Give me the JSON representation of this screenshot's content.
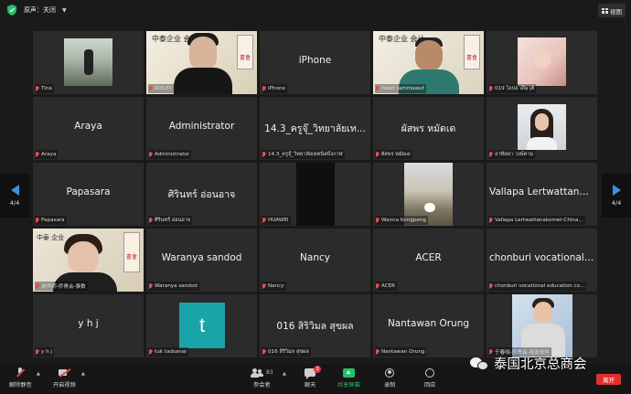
{
  "topbar": {
    "audio_label": "原声：关闭",
    "view_label": "视图"
  },
  "pagination": {
    "left": "4/4",
    "right": "4/4"
  },
  "tiles": [
    {
      "label": "Tina",
      "center": ""
    },
    {
      "label": "ROCKY",
      "center": "",
      "calligraphy": "中泰企业 会计",
      "scroll": "書會"
    },
    {
      "label": "iPhone",
      "center": "iPhone"
    },
    {
      "label": "Pawit tammawut",
      "center": "",
      "calligraphy": "中泰企业 会计",
      "scroll": "書會"
    },
    {
      "label": "019 ไอปอ เดิมวุติ",
      "center": ""
    },
    {
      "label": "Araya",
      "center": "Araya"
    },
    {
      "label": "Administrator",
      "center": "Administrator"
    },
    {
      "label": "14.3_ครูจุ๊_วิทยาลัยเทคนิคบึงกาฬ",
      "center": "14.3_ครูจุ๊_วิทยาลัยเท..."
    },
    {
      "label": "ผัสพร หมัดเด",
      "center": "ผัสพร หมัดเด"
    },
    {
      "label": "อาทิตยา วงษ์คาม",
      "center": ""
    },
    {
      "label": "Papasara",
      "center": "Papasara"
    },
    {
      "label": "ศิรินทร์ อ่อนอาจ",
      "center": "ศิรินทร์ อ่อนอาจ"
    },
    {
      "label": "HUAWEI",
      "center": ""
    },
    {
      "label": "Wanna Kongpeng",
      "center": ""
    },
    {
      "label": "Vallapa Lertwattanakomet-China...",
      "center": "Vallapa Lertwattanak..."
    },
    {
      "label": "谢师师-侨青会-泰数",
      "center": "",
      "calligraphy": "中泰 企业",
      "scroll": "書會"
    },
    {
      "label": "Waranya sandod",
      "center": "Waranya sandod"
    },
    {
      "label": "Nancy",
      "center": "Nancy"
    },
    {
      "label": "ACER",
      "center": "ACER"
    },
    {
      "label": "chonburi vocational education co...",
      "center": "chonburi vocational e..."
    },
    {
      "label": "y h j",
      "center": "y h j"
    },
    {
      "label": "tuk tadsanai",
      "center": "",
      "avatar": "t"
    },
    {
      "label": "016 สิริวิมล สุขผล",
      "center": "016 สิริวิมล สุขผล"
    },
    {
      "label": "Nantawan Orung",
      "center": "Nantawan Orung"
    },
    {
      "label": "于春晓-侨青会-用友软件",
      "center": ""
    }
  ],
  "toolbar": {
    "unmute": "解除静音",
    "start_video": "开启视频",
    "participants": "参会者",
    "participants_count": "83",
    "chat": "聊天",
    "chat_badge": "2",
    "share": "共享屏幕",
    "record": "录制",
    "reactions": "回应",
    "leave": "离开"
  },
  "watermark": {
    "text": "泰国北京总商会"
  },
  "colors": {
    "share_green": "#23c16b",
    "leave_red": "#e0302e",
    "nav_blue": "#3a8fe8",
    "muted_red": "#e05050"
  }
}
